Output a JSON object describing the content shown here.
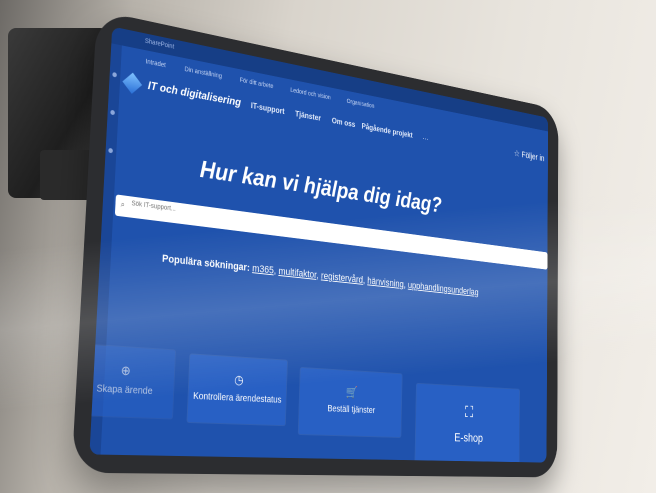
{
  "suite_bar": {
    "app_name": "SharePoint"
  },
  "site_nav": {
    "items": [
      "Intradet",
      "Din anställning",
      "För ditt arbete",
      "Ledord och vision",
      "Organisation"
    ],
    "chevron": "⌄"
  },
  "header": {
    "site_title": "IT och digitalisering",
    "nav": [
      "IT-support",
      "Tjänster",
      "Om oss",
      "Pågående projekt"
    ],
    "more": "···",
    "follow_label": "Följer in",
    "follow_icon": "star-icon"
  },
  "hero": {
    "title": "Hur kan vi hjälpa dig idag?",
    "search_placeholder": "Sök IT-support..."
  },
  "popular": {
    "label": "Populära sökningar:",
    "links": [
      "m365",
      "multifaktor",
      "registervård",
      "hänvisning",
      "upphandlingsunderlag"
    ],
    "separator": ", "
  },
  "tiles": [
    {
      "label": "Skapa ärende",
      "icon": "plus-icon"
    },
    {
      "label": "Kontrollera ärendestatus",
      "icon": "clock-icon"
    },
    {
      "label": "Beställ tjänster",
      "icon": "cart-icon"
    },
    {
      "label": "E-shop",
      "icon": "bag-icon"
    }
  ],
  "colors": {
    "brand_blue": "#1f52ad",
    "tile_blue": "#2860c4",
    "suite_bar": "#163e86"
  }
}
